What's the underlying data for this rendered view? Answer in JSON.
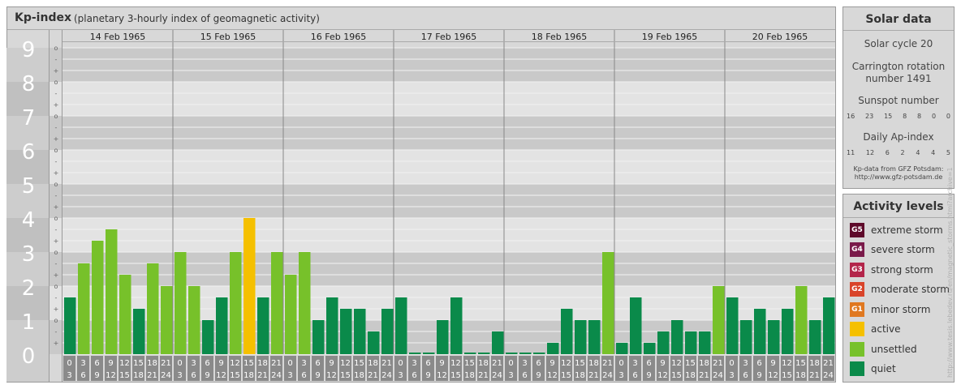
{
  "header": {
    "title": "Kp-index",
    "subtitle": "(planetary 3-hourly index of geomagnetic activity)"
  },
  "colors": {
    "extreme": "#5e0a2a",
    "severe": "#7a1a4a",
    "strong": "#b3254a",
    "moderate": "#d9442a",
    "minor": "#e07820",
    "active": "#f5c000",
    "unsettled": "#77c12a",
    "quiet": "#0a8a4a"
  },
  "chart_data": {
    "type": "bar",
    "title": "",
    "ylim": [
      0,
      9
    ],
    "y_ticks": [
      "0",
      "1",
      "2",
      "3",
      "4",
      "5",
      "6",
      "7",
      "8",
      "9"
    ],
    "sub_ticks": [
      "-",
      "o",
      "+"
    ],
    "days": [
      "14 Feb 1965",
      "15 Feb 1965",
      "16 Feb 1965",
      "17 Feb 1965",
      "18 Feb 1965",
      "19 Feb 1965",
      "20 Feb 1965"
    ],
    "hour_start": [
      "0",
      "3",
      "6",
      "9",
      "12",
      "15",
      "18",
      "21"
    ],
    "hour_end": [
      "3",
      "6",
      "9",
      "12",
      "15",
      "18",
      "21",
      "24"
    ],
    "values": [
      1.667,
      2.667,
      3.333,
      3.667,
      2.333,
      1.333,
      2.667,
      2.0,
      3.0,
      2.0,
      1.0,
      1.667,
      3.0,
      4.0,
      1.667,
      3.0,
      2.333,
      3.0,
      1.0,
      1.667,
      1.333,
      1.333,
      0.667,
      1.333,
      1.667,
      0.0,
      0.0,
      1.0,
      1.667,
      0.0,
      0.0,
      0.667,
      0.0,
      0.0,
      0.0,
      0.333,
      1.333,
      1.0,
      1.0,
      3.0,
      0.333,
      1.667,
      0.333,
      0.667,
      1.0,
      0.667,
      0.667,
      2.0,
      1.667,
      1.0,
      1.333,
      1.0,
      1.333,
      2.0,
      1.0,
      1.667
    ]
  },
  "solar": {
    "title": "Solar data",
    "cycle": "Solar cycle 20",
    "carrington_line1": "Carrington rotation",
    "carrington_line2": "number 1491",
    "sunspot_label": "Sunspot number",
    "sunspots": [
      "16",
      "23",
      "15",
      "8",
      "8",
      "0",
      "0"
    ],
    "ap_label": "Daily Ap-index",
    "ap": [
      "11",
      "12",
      "6",
      "2",
      "4",
      "4",
      "5"
    ],
    "source_line1": "Kp-data from GFZ Potsdam:",
    "source_line2": "http://www.gfz-potsdam.de"
  },
  "activity": {
    "title": "Activity levels",
    "items": [
      {
        "badge": "G5",
        "label": "extreme storm",
        "color": "#5e0a2a"
      },
      {
        "badge": "G4",
        "label": "severe storm",
        "color": "#7a1a4a"
      },
      {
        "badge": "G3",
        "label": "strong storm",
        "color": "#b3254a"
      },
      {
        "badge": "G2",
        "label": "moderate storm",
        "color": "#d9442a"
      },
      {
        "badge": "G1",
        "label": "minor storm",
        "color": "#e07820"
      },
      {
        "badge": "",
        "label": "active",
        "color": "#f5c000"
      },
      {
        "badge": "",
        "label": "unsettled",
        "color": "#77c12a"
      },
      {
        "badge": "",
        "label": "quiet",
        "color": "#0a8a4a"
      }
    ]
  },
  "credit": "http://www.tesis.lebedev.ru/en/magnetic_storms.html?archive=1"
}
